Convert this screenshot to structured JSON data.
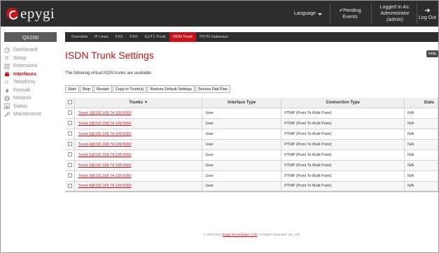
{
  "brand": {
    "name": "epygi",
    "accent": "#c4131b",
    "header_bg": "#2d2d2d"
  },
  "header": {
    "language_label": "Language",
    "pending_label": "Pending",
    "pending_sub": "Events",
    "logged_label": "Logged In As:",
    "logged_user": "Administrator (admin)",
    "logout_label": "Log Out"
  },
  "device": {
    "name": "QX200"
  },
  "sidebar": {
    "items": [
      {
        "label": "Dashboard",
        "icon": "dashboard-icon"
      },
      {
        "label": "Setup",
        "icon": "gear-icon"
      },
      {
        "label": "Extensions",
        "icon": "extensions-icon"
      },
      {
        "label": "Interfaces",
        "icon": "interfaces-icon",
        "active": true
      },
      {
        "label": "Telephony",
        "icon": "phone-icon"
      },
      {
        "label": "Firewall",
        "icon": "firewall-icon"
      },
      {
        "label": "Network",
        "icon": "network-icon"
      },
      {
        "label": "Status",
        "icon": "status-icon"
      },
      {
        "label": "Maintenance",
        "icon": "wrench-icon"
      }
    ]
  },
  "tabs": [
    {
      "label": "Overview"
    },
    {
      "label": "IP Lines"
    },
    {
      "label": "FXS"
    },
    {
      "label": "FXO"
    },
    {
      "label": "E1/T1 Trunk"
    },
    {
      "label": "ISDN Trunk",
      "active": true
    },
    {
      "label": "PSTN Gateways"
    }
  ],
  "main": {
    "title": "ISDN Trunk Settings",
    "help_label": "Help",
    "intro": "The following virtual ISDN trunks are available:",
    "actions": [
      "Start",
      "Stop",
      "Restart",
      "Copy to Trunk(s)",
      "Restore Default Settings",
      "Service Dial Plan"
    ]
  },
  "table": {
    "columns": [
      "Trunks",
      "Interface Type",
      "Connection Type",
      "Stats"
    ],
    "rows": [
      {
        "trunk": "Trunk 1@192.168.74.109:5060",
        "interface": "User",
        "connection": "PTMP (Point To Multi Point)",
        "stats": "N/A"
      },
      {
        "trunk": "Trunk 2@192.168.74.109:5060",
        "interface": "User",
        "connection": "PTMP (Point To Multi Point)",
        "stats": "N/A"
      },
      {
        "trunk": "Trunk 3@192.168.74.109:5060",
        "interface": "User",
        "connection": "PTMP (Point To Multi Point)",
        "stats": "N/A"
      },
      {
        "trunk": "Trunk 4@192.168.74.109:5060",
        "interface": "User",
        "connection": "PTMP (Point To Multi Point)",
        "stats": "N/A"
      },
      {
        "trunk": "Trunk 1@192.168.74.135:5060",
        "interface": "User",
        "connection": "PTMP (Point To Multi Point)",
        "stats": "N/A"
      },
      {
        "trunk": "Trunk 2@192.168.74.135:5060",
        "interface": "User",
        "connection": "PTMP (Point To Multi Point)",
        "stats": "N/A"
      },
      {
        "trunk": "Trunk 3@192.168.74.135:5060",
        "interface": "User",
        "connection": "PTMP (Point To Multi Point)",
        "stats": "N/A"
      },
      {
        "trunk": "Trunk 4@192.168.74.135:5060",
        "interface": "User",
        "connection": "PTMP (Point To Multi Point)",
        "stats": "N/A"
      }
    ]
  },
  "footer": {
    "prefix": "© 2000-2014",
    "company": "Epygi Technologies, LTD",
    "suffix": "All Rights Reserved. (en_US)"
  }
}
